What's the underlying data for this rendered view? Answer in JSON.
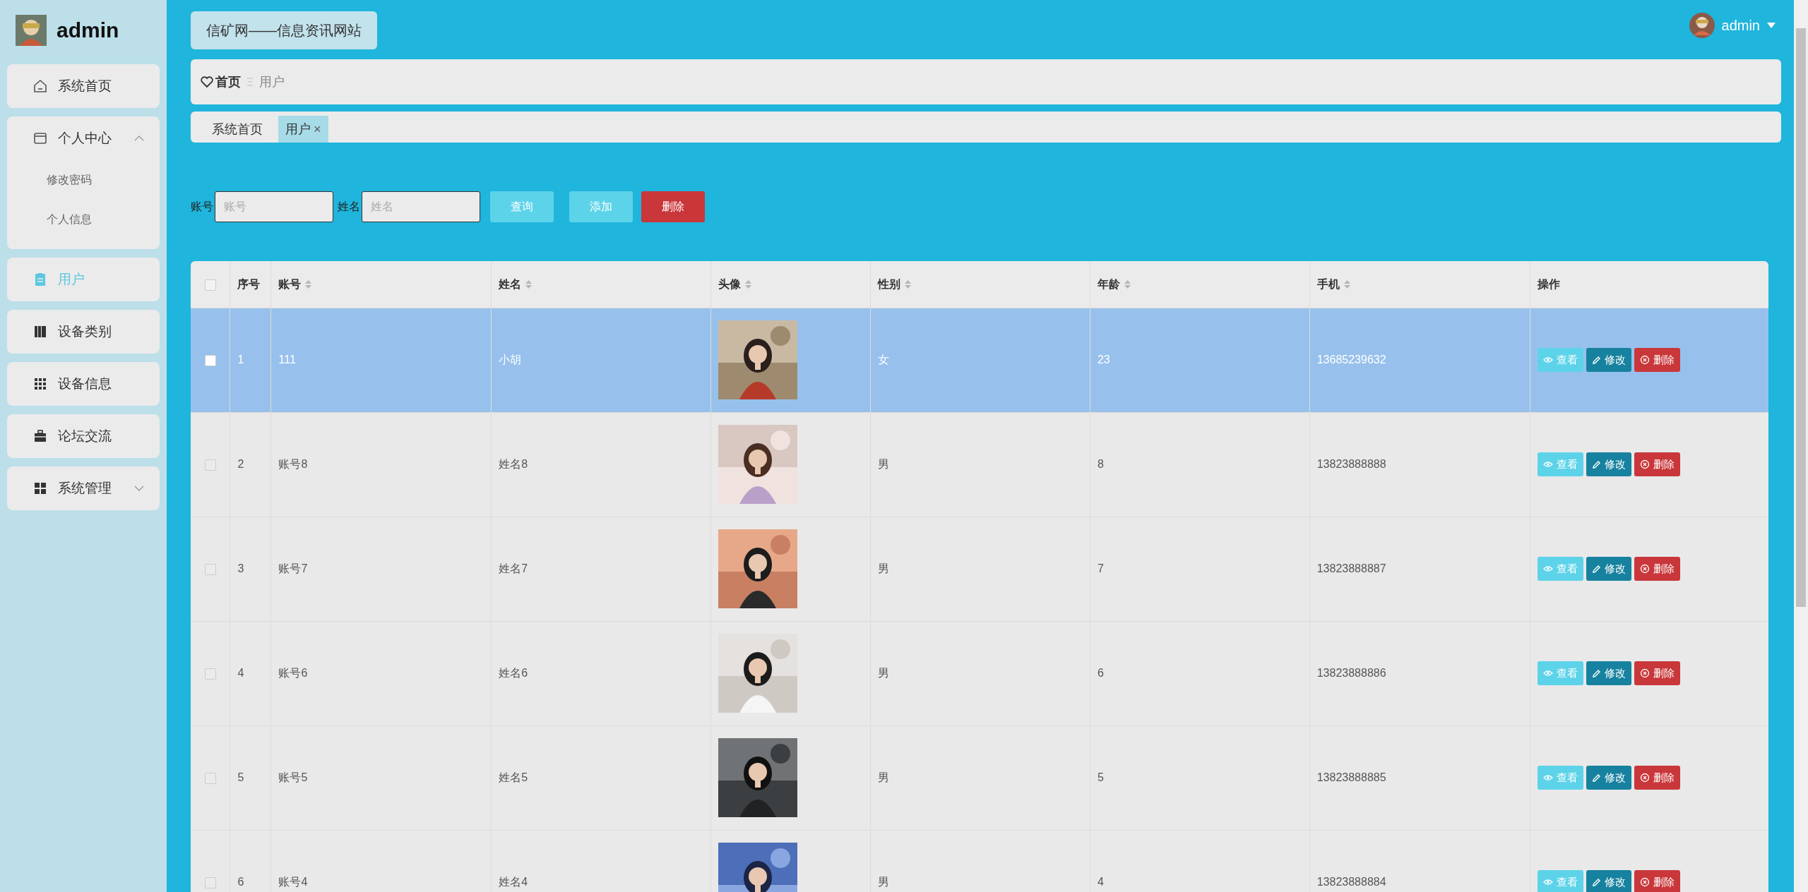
{
  "sidebar": {
    "user": "admin",
    "items": [
      {
        "label": "系统首页",
        "selected": false
      },
      {
        "label": "个人中心",
        "selected": false,
        "expanded": true,
        "children": [
          {
            "label": "修改密码"
          },
          {
            "label": "个人信息"
          }
        ]
      },
      {
        "label": "用户",
        "selected": true
      },
      {
        "label": "设备类别",
        "selected": false
      },
      {
        "label": "设备信息",
        "selected": false
      },
      {
        "label": "论坛交流",
        "selected": false
      },
      {
        "label": "系统管理",
        "selected": false,
        "expanded": false
      }
    ]
  },
  "header": {
    "site_title": "信矿网——信息资讯网站",
    "user": "admin"
  },
  "breadcrumb": [
    {
      "label": "首页",
      "kind": "home"
    },
    {
      "label": "用户",
      "kind": "current"
    }
  ],
  "tabs": [
    {
      "label": "系统首页",
      "selected": false
    },
    {
      "label": "用户",
      "selected": true,
      "close": "×"
    }
  ],
  "filters": [
    {
      "label": "账号",
      "placeholder": "账号"
    },
    {
      "label": "姓名",
      "placeholder": "姓名"
    }
  ],
  "actions": [
    {
      "label": "查询",
      "kind": "search"
    },
    {
      "label": "添加",
      "kind": "add"
    },
    {
      "label": "删除",
      "kind": "delete"
    }
  ],
  "table": {
    "select_all": {
      "checked": false
    },
    "columns": [
      {
        "label": "序号",
        "sortable": false
      },
      {
        "label": "账号",
        "sortable": true
      },
      {
        "label": "姓名",
        "sortable": true
      },
      {
        "label": "头像",
        "sortable": true
      },
      {
        "label": "性别",
        "sortable": true
      },
      {
        "label": "年龄",
        "sortable": true
      },
      {
        "label": "手机",
        "sortable": true
      },
      {
        "label": "操作",
        "sortable": false
      }
    ],
    "rows": [
      {
        "selected": true,
        "checked": false,
        "cells": [
          "1",
          "111",
          "小胡",
          {
            "kind": "picture"
          },
          "女",
          "23",
          "13685239632"
        ],
        "buttons": [
          {
            "kind": "view",
            "label": "查看"
          },
          {
            "kind": "edit",
            "label": "修改"
          },
          {
            "kind": "delete",
            "label": "删除"
          }
        ]
      },
      {
        "selected": false,
        "checked": false,
        "cells": [
          "2",
          "账号8",
          "姓名8",
          {
            "kind": "picture"
          },
          "男",
          "8",
          "13823888888"
        ],
        "buttons": [
          {
            "kind": "view",
            "label": "查看"
          },
          {
            "kind": "edit",
            "label": "修改"
          },
          {
            "kind": "delete",
            "label": "删除"
          }
        ]
      },
      {
        "selected": false,
        "checked": false,
        "cells": [
          "3",
          "账号7",
          "姓名7",
          {
            "kind": "picture"
          },
          "男",
          "7",
          "13823888887"
        ],
        "buttons": [
          {
            "kind": "view",
            "label": "查看"
          },
          {
            "kind": "edit",
            "label": "修改"
          },
          {
            "kind": "delete",
            "label": "删除"
          }
        ]
      },
      {
        "selected": false,
        "checked": false,
        "cells": [
          "4",
          "账号6",
          "姓名6",
          {
            "kind": "picture"
          },
          "男",
          "6",
          "13823888886"
        ],
        "buttons": [
          {
            "kind": "view",
            "label": "查看"
          },
          {
            "kind": "edit",
            "label": "修改"
          },
          {
            "kind": "delete",
            "label": "删除"
          }
        ]
      },
      {
        "selected": false,
        "checked": false,
        "cells": [
          "5",
          "账号5",
          "姓名5",
          {
            "kind": "picture"
          },
          "男",
          "5",
          "13823888885"
        ],
        "buttons": [
          {
            "kind": "view",
            "label": "查看"
          },
          {
            "kind": "edit",
            "label": "修改"
          },
          {
            "kind": "delete",
            "label": "删除"
          }
        ]
      },
      {
        "selected": false,
        "checked": false,
        "cells": [
          "6",
          "账号4",
          "姓名4",
          {
            "kind": "picture"
          },
          "男",
          "4",
          "13823888884"
        ],
        "buttons": [
          {
            "kind": "view",
            "label": "查看"
          },
          {
            "kind": "edit",
            "label": "修改"
          },
          {
            "kind": "delete",
            "label": "删除"
          }
        ]
      }
    ]
  }
}
